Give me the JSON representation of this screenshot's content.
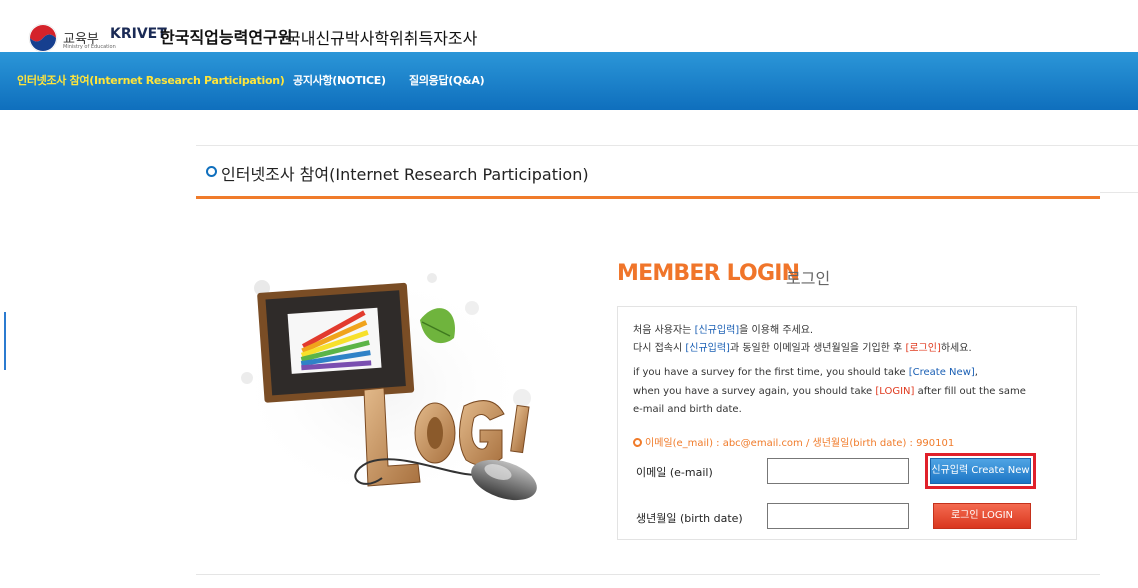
{
  "header": {
    "ministry_name": "교육부",
    "ministry_sub": "Ministry of Education",
    "org_name_en": "KRIVET",
    "org_name_kr": "한국직업능력연구원",
    "survey_title": "국내신규박사학위취득자조사"
  },
  "nav": {
    "items": [
      {
        "label": "인터넷조사 참여(Internet Research Participation)"
      },
      {
        "label": "공지사항(NOTICE)"
      },
      {
        "label": "질의응답(Q&A)"
      }
    ]
  },
  "page": {
    "title": "인터넷조사 참여(Internet Research Participation)"
  },
  "login": {
    "title": "MEMBER LOGIN",
    "title_kr": "로그인",
    "instructions_kr": {
      "line1_pre": "처음 사용자는 ",
      "line1_link": "[신규입력]",
      "line1_post": "을 이용해 주세요.",
      "line2_pre": "다시 접속시 ",
      "line2_link": "[신규입력]",
      "line2_mid": "과 동일한 이메일과 생년월일을 기입한 후 ",
      "line2_link2": "[로그인]",
      "line2_post": "하세요."
    },
    "instructions_en": {
      "line1_pre": "if you have a survey for the first time, you should take ",
      "line1_link": "[Create New]",
      "line1_post": ",",
      "line2_pre": "when you have a survey again, you should take ",
      "line2_link": "[LOGIN]",
      "line2_post": " after fill out the same",
      "line3": "e-mail and birth date."
    },
    "example": "이메일(e_mail) : abc@email.com  /  생년월일(birth date) : 990101",
    "email_label": "이메일 (e-mail)",
    "email_value": "",
    "birth_label": "생년월일 (birth date)",
    "birth_value": "",
    "create_new_label": "신규입력 Create New",
    "login_label": "로그인 LOGIN"
  },
  "illustration": {
    "text": "LOGIN",
    "icon": "login-illustration"
  },
  "colors": {
    "nav_bg": "#1a7fc9",
    "nav_active": "#ffe53b",
    "accent_orange": "#f07b2a",
    "link_blue": "#1a5fb4",
    "link_red": "#e03a1f",
    "highlight_red": "#e0202a"
  }
}
